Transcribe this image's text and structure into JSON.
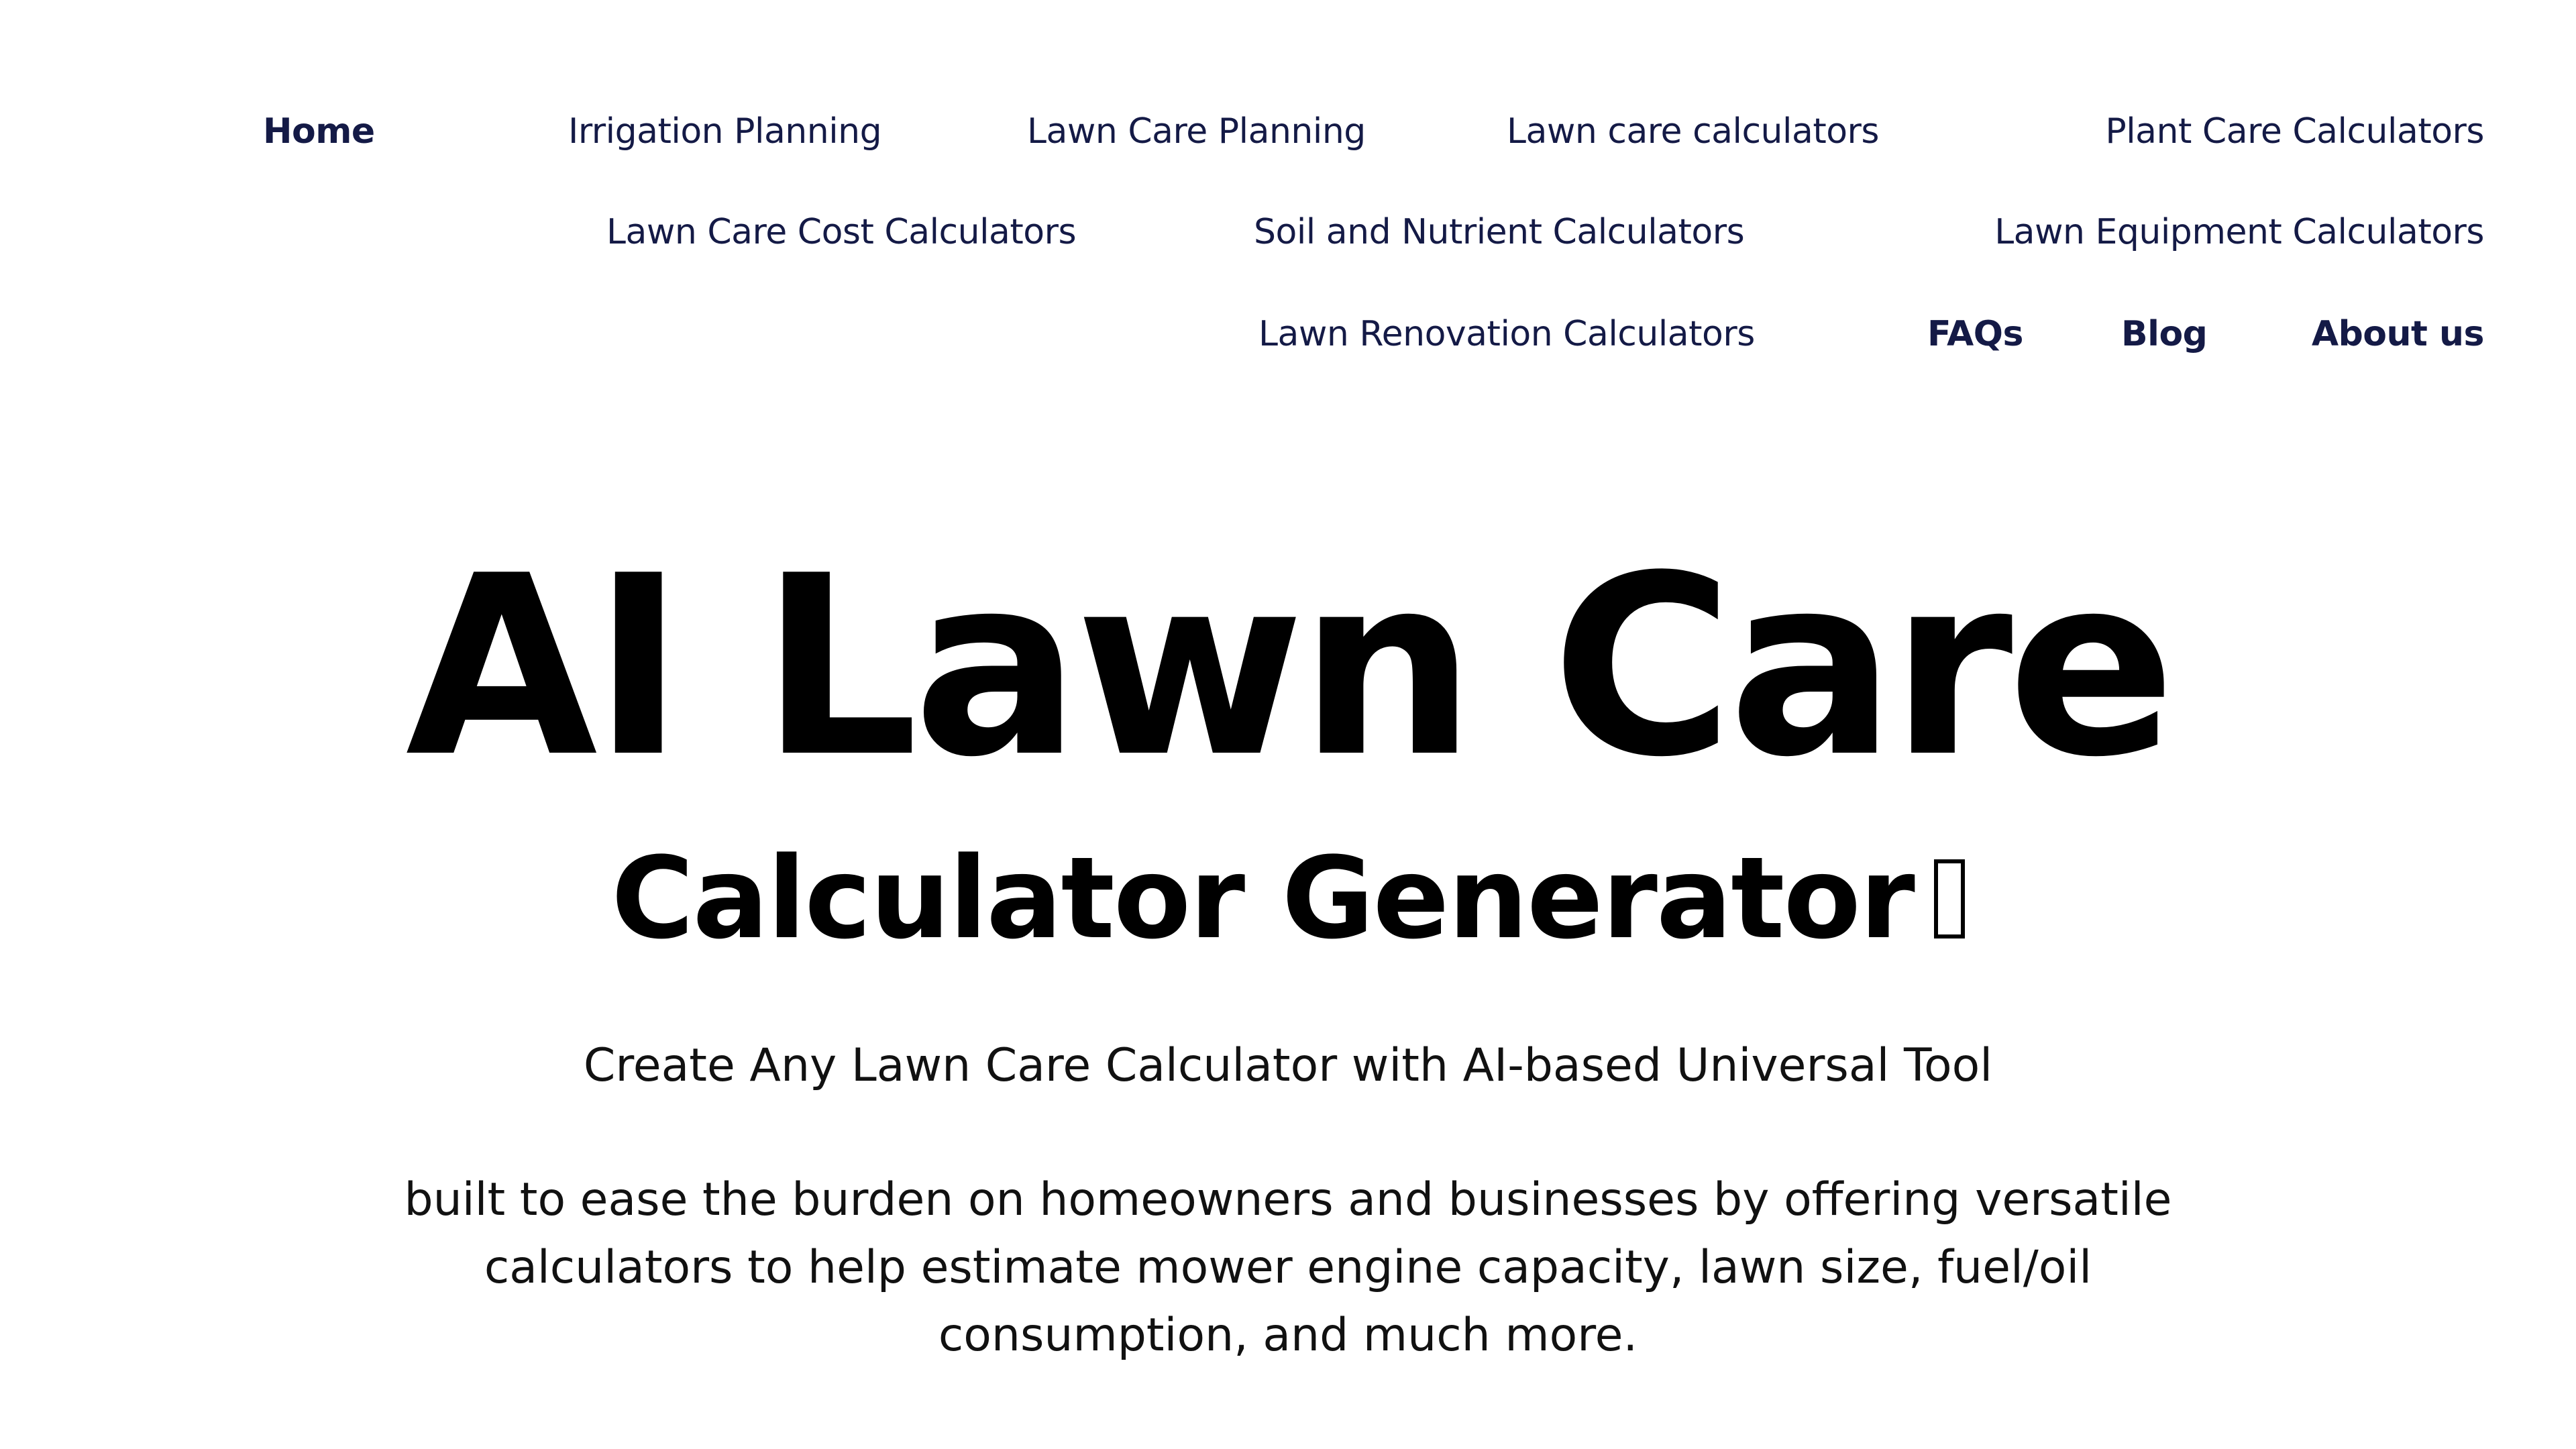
{
  "nav": {
    "row1": [
      {
        "label": "Home",
        "bold": true
      },
      {
        "label": "Irrigation Planning",
        "bold": false
      },
      {
        "label": "Lawn Care Planning",
        "bold": false
      },
      {
        "label": "Lawn care calculators",
        "bold": false
      },
      {
        "label": "Plant Care Calculators",
        "bold": false
      }
    ],
    "row2": [
      {
        "label": "Lawn Care Cost Calculators",
        "bold": false
      },
      {
        "label": "Soil and Nutrient Calculators",
        "bold": false
      },
      {
        "label": "Lawn Equipment Calculators",
        "bold": false
      }
    ],
    "row3": [
      {
        "label": "Lawn Renovation Calculators",
        "bold": false
      },
      {
        "label": "FAQs",
        "bold": true
      },
      {
        "label": "Blog",
        "bold": true
      },
      {
        "label": "About us",
        "bold": true
      }
    ]
  },
  "hero": {
    "title": "AI Lawn Care",
    "subtitle": "Calculator Generator",
    "subtitle_icon": "missing-glyph-icon",
    "tagline": "Create Any Lawn Care Calculator with AI-based Universal Tool",
    "description": "built to ease the burden on homeowners and businesses by offering versatile calculators to help estimate mower engine capacity, lawn size, fuel/oil consumption, and much more."
  },
  "colors": {
    "nav_text": "#141a46",
    "heading_text": "#000000",
    "body_text": "#111111",
    "background": "#ffffff"
  }
}
